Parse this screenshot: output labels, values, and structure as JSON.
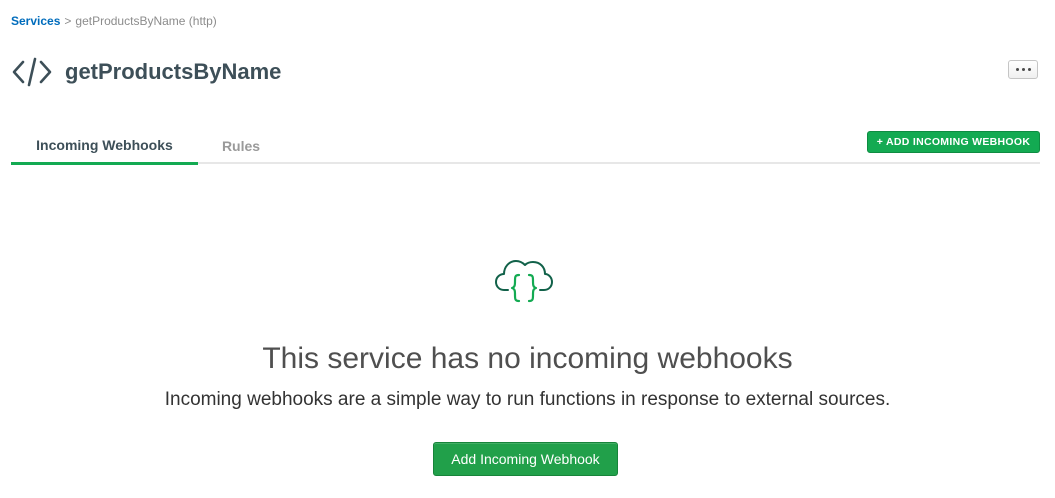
{
  "breadcrumb": {
    "root": "Services",
    "separator": ">",
    "current": "getProductsByName (http)"
  },
  "header": {
    "title": "getProductsByName",
    "icon": "code-brackets-icon",
    "more_icon": "ellipsis-icon"
  },
  "tabs": [
    {
      "label": "Incoming Webhooks",
      "active": true
    },
    {
      "label": "Rules",
      "active": false
    }
  ],
  "toolbar": {
    "add_button_label": "+ ADD INCOMING WEBHOOK"
  },
  "empty_state": {
    "icon": "cloud-braces-icon",
    "title": "This service has no incoming webhooks",
    "description": "Incoming webhooks are a simple way to run functions in response to external sources.",
    "button_label": "Add Incoming Webhook"
  },
  "colors": {
    "accent_green": "#13aa52",
    "link_blue": "#006cbc",
    "icon_dark_green": "#116149"
  }
}
